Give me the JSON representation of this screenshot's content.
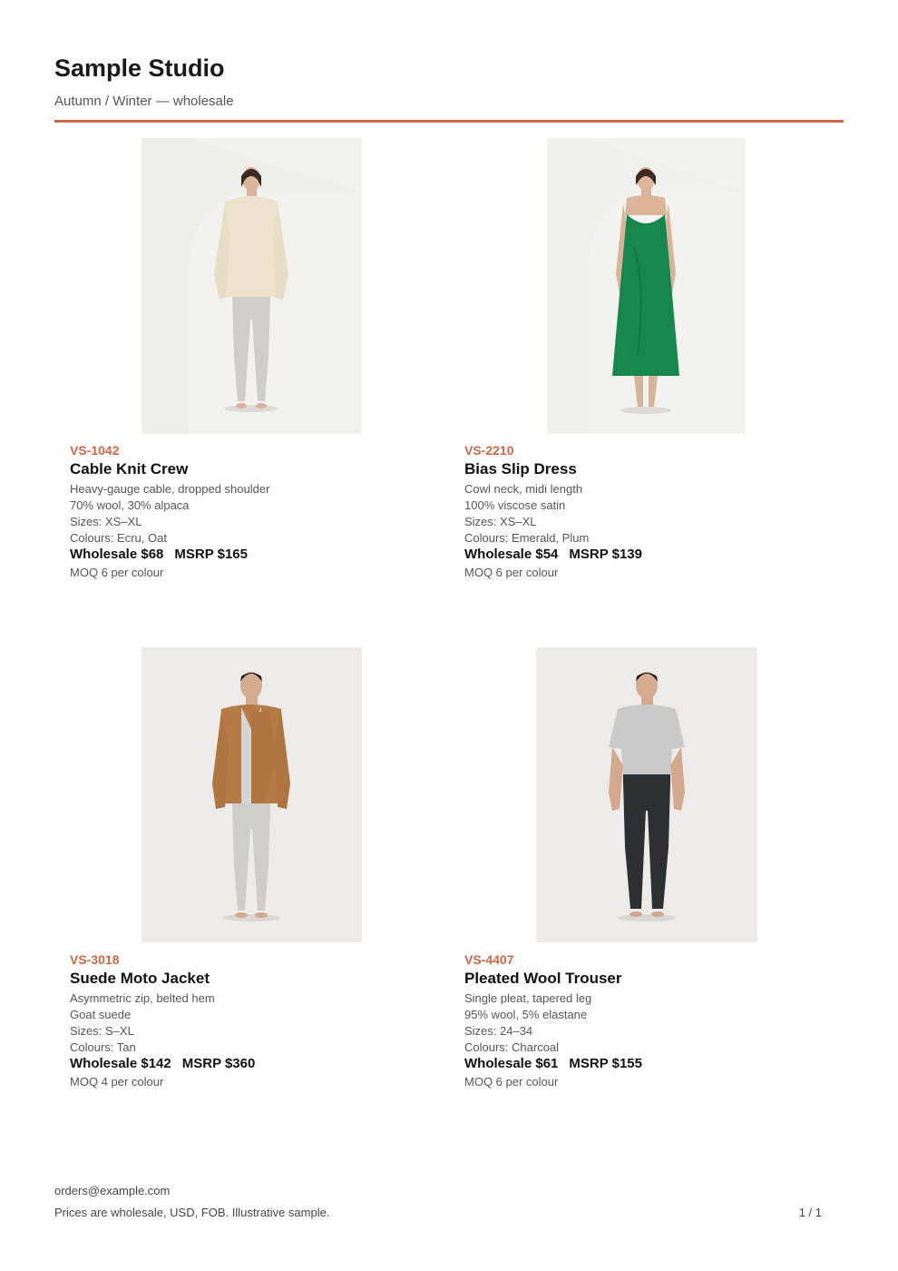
{
  "header": {
    "brand": "Sample Studio",
    "subtitle": "Autumn / Winter — wholesale",
    "accent_color": "#c8694a"
  },
  "products": [
    {
      "sku": "VS-1042",
      "name": "Cable Knit Crew",
      "details": [
        "Heavy-gauge cable, dropped shoulder",
        "70% wool, 30% alpaca",
        "Sizes: XS–XL",
        "Colours: Ecru, Oat"
      ],
      "wholesale": "Wholesale $68",
      "msrp": "MSRP $165",
      "moq": "MOQ 6 per colour"
    },
    {
      "sku": "VS-2210",
      "name": "Bias Slip Dress",
      "details": [
        "Cowl neck, midi length",
        "100% viscose satin",
        "Sizes: XS–XL",
        "Colours: Emerald, Plum"
      ],
      "wholesale": "Wholesale $54",
      "msrp": "MSRP $139",
      "moq": "MOQ 6 per colour"
    },
    {
      "sku": "VS-3018",
      "name": "Suede Moto Jacket",
      "details": [
        "Asymmetric zip, belted hem",
        "Goat suede",
        "Sizes: S–XL",
        "Colours: Tan"
      ],
      "wholesale": "Wholesale $142",
      "msrp": "MSRP $360",
      "moq": "MOQ 4 per colour"
    },
    {
      "sku": "VS-4407",
      "name": "Pleated Wool Trouser",
      "details": [
        "Single pleat, tapered leg",
        "95% wool, 5% elastane",
        "Sizes: 24–34",
        "Colours: Charcoal"
      ],
      "wholesale": "Wholesale $61",
      "msrp": "MSRP $155",
      "moq": "MOQ 6 per colour"
    }
  ],
  "footer": {
    "email": "orders@example.com",
    "note": "Prices are wholesale, USD, FOB. Illustrative sample.",
    "page": "1 / 1"
  }
}
